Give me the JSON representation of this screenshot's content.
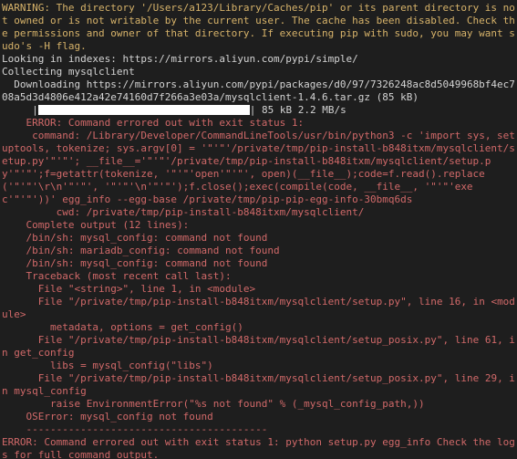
{
  "warning": {
    "label": "WARNING:",
    "text": " The directory '/Users/a123/Library/Caches/pip' or its parent directory is not owned or is not writable by the current user. The cache has been disabled. Check the permissions and owner of that directory. If executing pip with sudo, you may want sudo's -H flag."
  },
  "looking": "Looking in indexes: https://mirrors.aliyun.com/pypi/simple/",
  "collecting": "Collecting mysqlclient",
  "downloading": "  Downloading https://mirrors.aliyun.com/pypi/packages/d0/97/7326248ac8d5049968bf4ec708a5d3d4806e412a42e74160d7f266a3e03a/mysqlclient-1.4.6.tar.gz (85 kB)",
  "progress": {
    "prefix": "     |",
    "suffix": "| 85 kB 2.2 MB/s"
  },
  "err1": {
    "l1": "    ERROR: Command errored out with exit status 1:",
    "l2": "     command: /Library/Developer/CommandLineTools/usr/bin/python3 -c 'import sys, setuptools, tokenize; sys.argv[0] = '\"'\"'/private/tmp/pip-install-b848itxm/mysqlclient/setup.py'\"'\"'; __file__='\"'\"'/private/tmp/pip-install-b848itxm/mysqlclient/setup.py'\"'\"';f=getattr(tokenize, '\"'\"'open'\"'\"', open)(__file__);code=f.read().replace('\"'\"'\\r\\n'\"'\"', '\"'\"'\\n'\"'\"');f.close();exec(compile(code, __file__, '\"'\"'exec'\"'\"'))' egg_info --egg-base /private/tmp/pip-pip-egg-info-30bmq6ds",
    "l3": "         cwd: /private/tmp/pip-install-b848itxm/mysqlclient/",
    "l4": "    Complete output (12 lines):",
    "l5": "    /bin/sh: mysql_config: command not found",
    "l6": "    /bin/sh: mariadb_config: command not found",
    "l7": "    /bin/sh: mysql_config: command not found",
    "l8": "    Traceback (most recent call last):",
    "l9": "      File \"<string>\", line 1, in <module>",
    "l10": "      File \"/private/tmp/pip-install-b848itxm/mysqlclient/setup.py\", line 16, in <module>",
    "l11": "        metadata, options = get_config()",
    "l12": "      File \"/private/tmp/pip-install-b848itxm/mysqlclient/setup_posix.py\", line 61, in get_config",
    "l13": "        libs = mysql_config(\"libs\")",
    "l14": "      File \"/private/tmp/pip-install-b848itxm/mysqlclient/setup_posix.py\", line 29, in mysql_config",
    "l15": "        raise EnvironmentError(\"%s not found\" % (_mysql_config_path,))",
    "l16": "    OSError: mysql_config not found",
    "l17": "    ----------------------------------------"
  },
  "err2": "ERROR: Command errored out with exit status 1: python setup.py egg_info Check the logs for full command output."
}
